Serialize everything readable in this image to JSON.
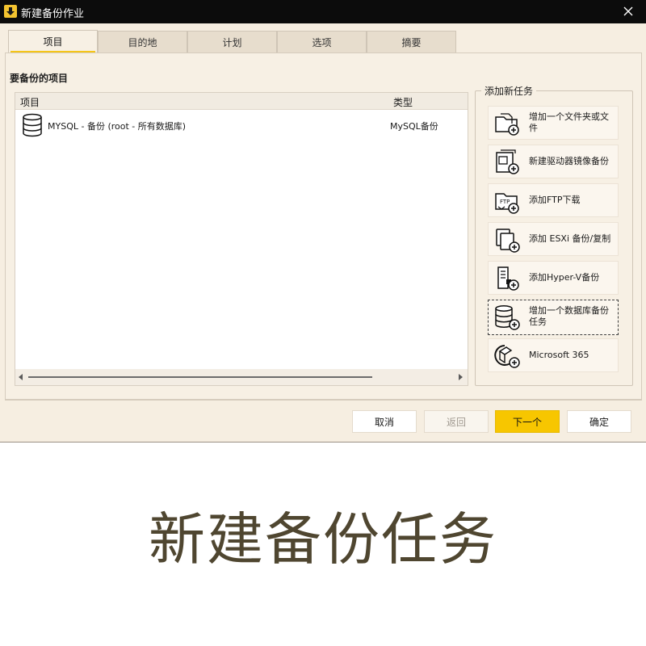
{
  "window": {
    "title": "新建备份作业"
  },
  "tabs": [
    {
      "label": "项目",
      "active": true
    },
    {
      "label": "目的地",
      "active": false
    },
    {
      "label": "计划",
      "active": false
    },
    {
      "label": "选项",
      "active": false
    },
    {
      "label": "摘要",
      "active": false
    }
  ],
  "items_section": {
    "title": "要备份的项目",
    "columns": {
      "name": "项目",
      "type": "类型"
    },
    "rows": [
      {
        "name": "MYSQL - 备份 (root - 所有数据库)",
        "type": "MySQL备份",
        "icon": "database-icon"
      }
    ]
  },
  "add_task": {
    "title": "添加新任务",
    "buttons": [
      {
        "label": "增加一个文件夹或文件",
        "icon": "folder-file-icon"
      },
      {
        "label": "新建驱动器镜像备份",
        "icon": "drive-image-icon"
      },
      {
        "label": "添加FTP下载",
        "icon": "ftp-folder-icon"
      },
      {
        "label": "添加 ESXi 备份/复制",
        "icon": "esxi-copy-icon"
      },
      {
        "label": "添加Hyper-V备份",
        "icon": "hyperv-server-icon"
      },
      {
        "label": "增加一个数据库备份任务",
        "icon": "database-add-icon",
        "selected": true
      },
      {
        "label": "Microsoft 365",
        "icon": "microsoft365-icon"
      }
    ]
  },
  "footer": {
    "cancel": "取消",
    "back": "返回",
    "next": "下一个",
    "ok": "确定"
  },
  "caption": "新建备份任务",
  "colors": {
    "accent": "#f7c600",
    "titlebar": "#0c0c0c",
    "panel": "#f7f0e4",
    "caption": "#4f4630"
  }
}
